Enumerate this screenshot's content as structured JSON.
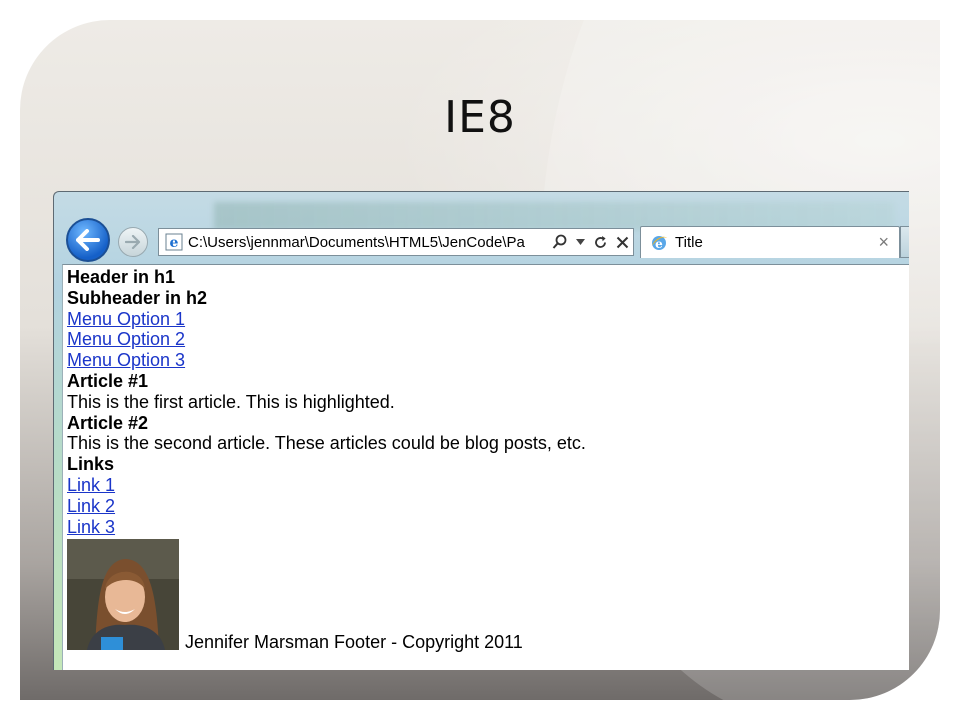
{
  "slide": {
    "title": "IE8"
  },
  "browser": {
    "address": "C:\\Users\\jennmar\\Documents\\HTML5\\JenCode\\Pa",
    "tab_title": "Title",
    "tab_close": "×",
    "icons": {
      "back": "back-arrow-icon",
      "forward": "forward-arrow-icon",
      "page": "ie-logo-icon",
      "search": "search-icon",
      "dropdown": "chevron-down-icon",
      "refresh": "refresh-icon",
      "stop": "close-icon"
    }
  },
  "page": {
    "header_h1": "Header in h1",
    "subheader_h2": "Subheader in h2",
    "menu": [
      "Menu Option 1",
      "Menu Option 2",
      "Menu Option 3"
    ],
    "articles": [
      {
        "title": "Article #1",
        "body": "This is the first article. This is highlighted."
      },
      {
        "title": "Article #2",
        "body": "This is the second article. These articles could be blog posts, etc."
      }
    ],
    "links_heading": "Links",
    "links": [
      "Link 1",
      "Link 2",
      "Link 3"
    ],
    "footer": "Jennifer Marsman Footer - Copyright 2011"
  },
  "colors": {
    "link": "#1a35c9",
    "back_button": "#1560c8"
  }
}
